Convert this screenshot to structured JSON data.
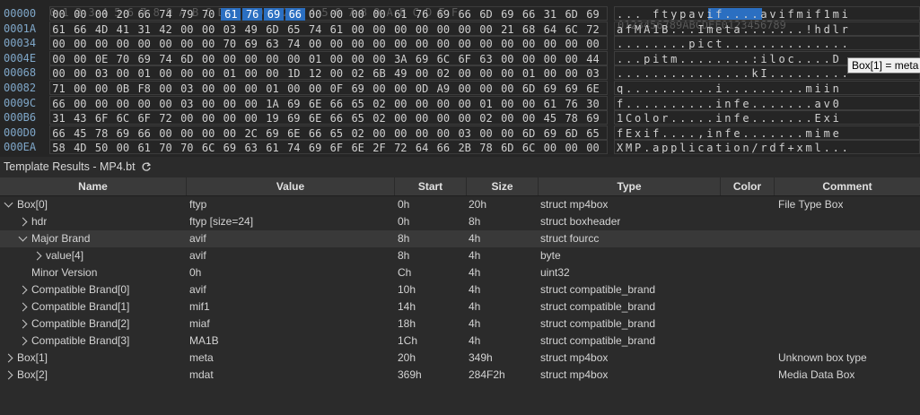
{
  "hex": {
    "ruler_hex": "0 1 2 3 4 5 6 7 8 9 A B C D E F 0 1 2 3 4 5 6 7 8 9 A B C D E F",
    "ruler_ascii": "0123456789ABCDEF0123456789",
    "rows": [
      {
        "offset": "00000",
        "bytes": [
          "00",
          "00",
          "00",
          "20",
          "66",
          "74",
          "79",
          "70",
          "61",
          "76",
          "69",
          "66",
          "00",
          "00",
          "00",
          "00",
          "61",
          "76",
          "69",
          "66",
          "6D",
          "69",
          "66",
          "31",
          "6D",
          "69"
        ],
        "ascii": "... ftypavif....avifmif1mi"
      },
      {
        "offset": "0001A",
        "bytes": [
          "61",
          "66",
          "4D",
          "41",
          "31",
          "42",
          "00",
          "00",
          "03",
          "49",
          "6D",
          "65",
          "74",
          "61",
          "00",
          "00",
          "00",
          "00",
          "00",
          "00",
          "00",
          "21",
          "68",
          "64",
          "6C",
          "72"
        ],
        "ascii": "afMA1B...Imeta.......!hdlr"
      },
      {
        "offset": "00034",
        "bytes": [
          "00",
          "00",
          "00",
          "00",
          "00",
          "00",
          "00",
          "00",
          "70",
          "69",
          "63",
          "74",
          "00",
          "00",
          "00",
          "00",
          "00",
          "00",
          "00",
          "00",
          "00",
          "00",
          "00",
          "00",
          "00",
          "00"
        ],
        "ascii": "........pict.............."
      },
      {
        "offset": "0004E",
        "bytes": [
          "00",
          "00",
          "0E",
          "70",
          "69",
          "74",
          "6D",
          "00",
          "00",
          "00",
          "00",
          "00",
          "01",
          "00",
          "00",
          "00",
          "3A",
          "69",
          "6C",
          "6F",
          "63",
          "00",
          "00",
          "00",
          "00",
          "44"
        ],
        "ascii": "...pitm........:iloc....D"
      },
      {
        "offset": "00068",
        "bytes": [
          "00",
          "00",
          "03",
          "00",
          "01",
          "00",
          "00",
          "00",
          "01",
          "00",
          "00",
          "1D",
          "12",
          "00",
          "02",
          "6B",
          "49",
          "00",
          "02",
          "00",
          "00",
          "00",
          "01",
          "00",
          "00",
          "03"
        ],
        "ascii": "...............kI........."
      },
      {
        "offset": "00082",
        "bytes": [
          "71",
          "00",
          "00",
          "0B",
          "F8",
          "00",
          "03",
          "00",
          "00",
          "00",
          "01",
          "00",
          "00",
          "0F",
          "69",
          "00",
          "00",
          "0D",
          "A9",
          "00",
          "00",
          "00",
          "6D",
          "69",
          "69",
          "6E"
        ],
        "ascii": "q..........i.........miin"
      },
      {
        "offset": "0009C",
        "bytes": [
          "66",
          "00",
          "00",
          "00",
          "00",
          "00",
          "03",
          "00",
          "00",
          "00",
          "1A",
          "69",
          "6E",
          "66",
          "65",
          "02",
          "00",
          "00",
          "00",
          "00",
          "01",
          "00",
          "00",
          "61",
          "76",
          "30"
        ],
        "ascii": "f..........infe.......av0"
      },
      {
        "offset": "000B6",
        "bytes": [
          "31",
          "43",
          "6F",
          "6C",
          "6F",
          "72",
          "00",
          "00",
          "00",
          "00",
          "19",
          "69",
          "6E",
          "66",
          "65",
          "02",
          "00",
          "00",
          "00",
          "00",
          "02",
          "00",
          "00",
          "45",
          "78",
          "69"
        ],
        "ascii": "1Color.....infe.......Exi"
      },
      {
        "offset": "000D0",
        "bytes": [
          "66",
          "45",
          "78",
          "69",
          "66",
          "00",
          "00",
          "00",
          "00",
          "2C",
          "69",
          "6E",
          "66",
          "65",
          "02",
          "00",
          "00",
          "00",
          "00",
          "03",
          "00",
          "00",
          "6D",
          "69",
          "6D",
          "65"
        ],
        "ascii": "fExif....,infe.......mime"
      },
      {
        "offset": "000EA",
        "bytes": [
          "58",
          "4D",
          "50",
          "00",
          "61",
          "70",
          "70",
          "6C",
          "69",
          "63",
          "61",
          "74",
          "69",
          "6F",
          "6E",
          "2F",
          "72",
          "64",
          "66",
          "2B",
          "78",
          "6D",
          "6C",
          "00",
          "00",
          "00"
        ],
        "ascii": "XMP.application/rdf+xml..."
      }
    ],
    "tooltip": "Box[1] = meta"
  },
  "panel": {
    "title": "Template Results - MP4.bt",
    "refresh_icon": "refresh-icon"
  },
  "columns": {
    "name": "Name",
    "value": "Value",
    "start": "Start",
    "size": "Size",
    "type": "Type",
    "color": "Color",
    "comment": "Comment"
  },
  "rows": [
    {
      "name": "Box[0]",
      "value": "ftyp",
      "start": "0h",
      "size": "20h",
      "type": "struct mp4box",
      "color": "",
      "comment": "File Type Box"
    },
    {
      "name": "hdr",
      "value": "ftyp [size=24]",
      "start": "0h",
      "size": "8h",
      "type": "struct boxheader",
      "color": "",
      "comment": ""
    },
    {
      "name": "Major Brand",
      "value": "avif",
      "start": "8h",
      "size": "4h",
      "type": "struct fourcc",
      "color": "",
      "comment": ""
    },
    {
      "name": "value[4]",
      "value": "avif",
      "start": "8h",
      "size": "4h",
      "type": "byte",
      "color": "",
      "comment": ""
    },
    {
      "name": "Minor Version",
      "value": "0h",
      "start": "Ch",
      "size": "4h",
      "type": "uint32",
      "color": "",
      "comment": ""
    },
    {
      "name": "Compatible Brand[0]",
      "value": "avif",
      "start": "10h",
      "size": "4h",
      "type": "struct compatible_brand",
      "color": "",
      "comment": ""
    },
    {
      "name": "Compatible Brand[1]",
      "value": "mif1",
      "start": "14h",
      "size": "4h",
      "type": "struct compatible_brand",
      "color": "",
      "comment": ""
    },
    {
      "name": "Compatible Brand[2]",
      "value": "miaf",
      "start": "18h",
      "size": "4h",
      "type": "struct compatible_brand",
      "color": "",
      "comment": ""
    },
    {
      "name": "Compatible Brand[3]",
      "value": "MA1B",
      "start": "1Ch",
      "size": "4h",
      "type": "struct compatible_brand",
      "color": "",
      "comment": ""
    },
    {
      "name": "Box[1]",
      "value": "meta",
      "start": "20h",
      "size": "349h",
      "type": "struct mp4box",
      "color": "",
      "comment": "Unknown box type"
    },
    {
      "name": "Box[2]",
      "value": "mdat",
      "start": "369h",
      "size": "284F2h",
      "type": "struct mp4box",
      "color": "",
      "comment": "Media Data Box"
    }
  ],
  "colors": {
    "selection": "#2b6fc1",
    "background": "#2b2b2b",
    "header": "#3a3a3a"
  }
}
